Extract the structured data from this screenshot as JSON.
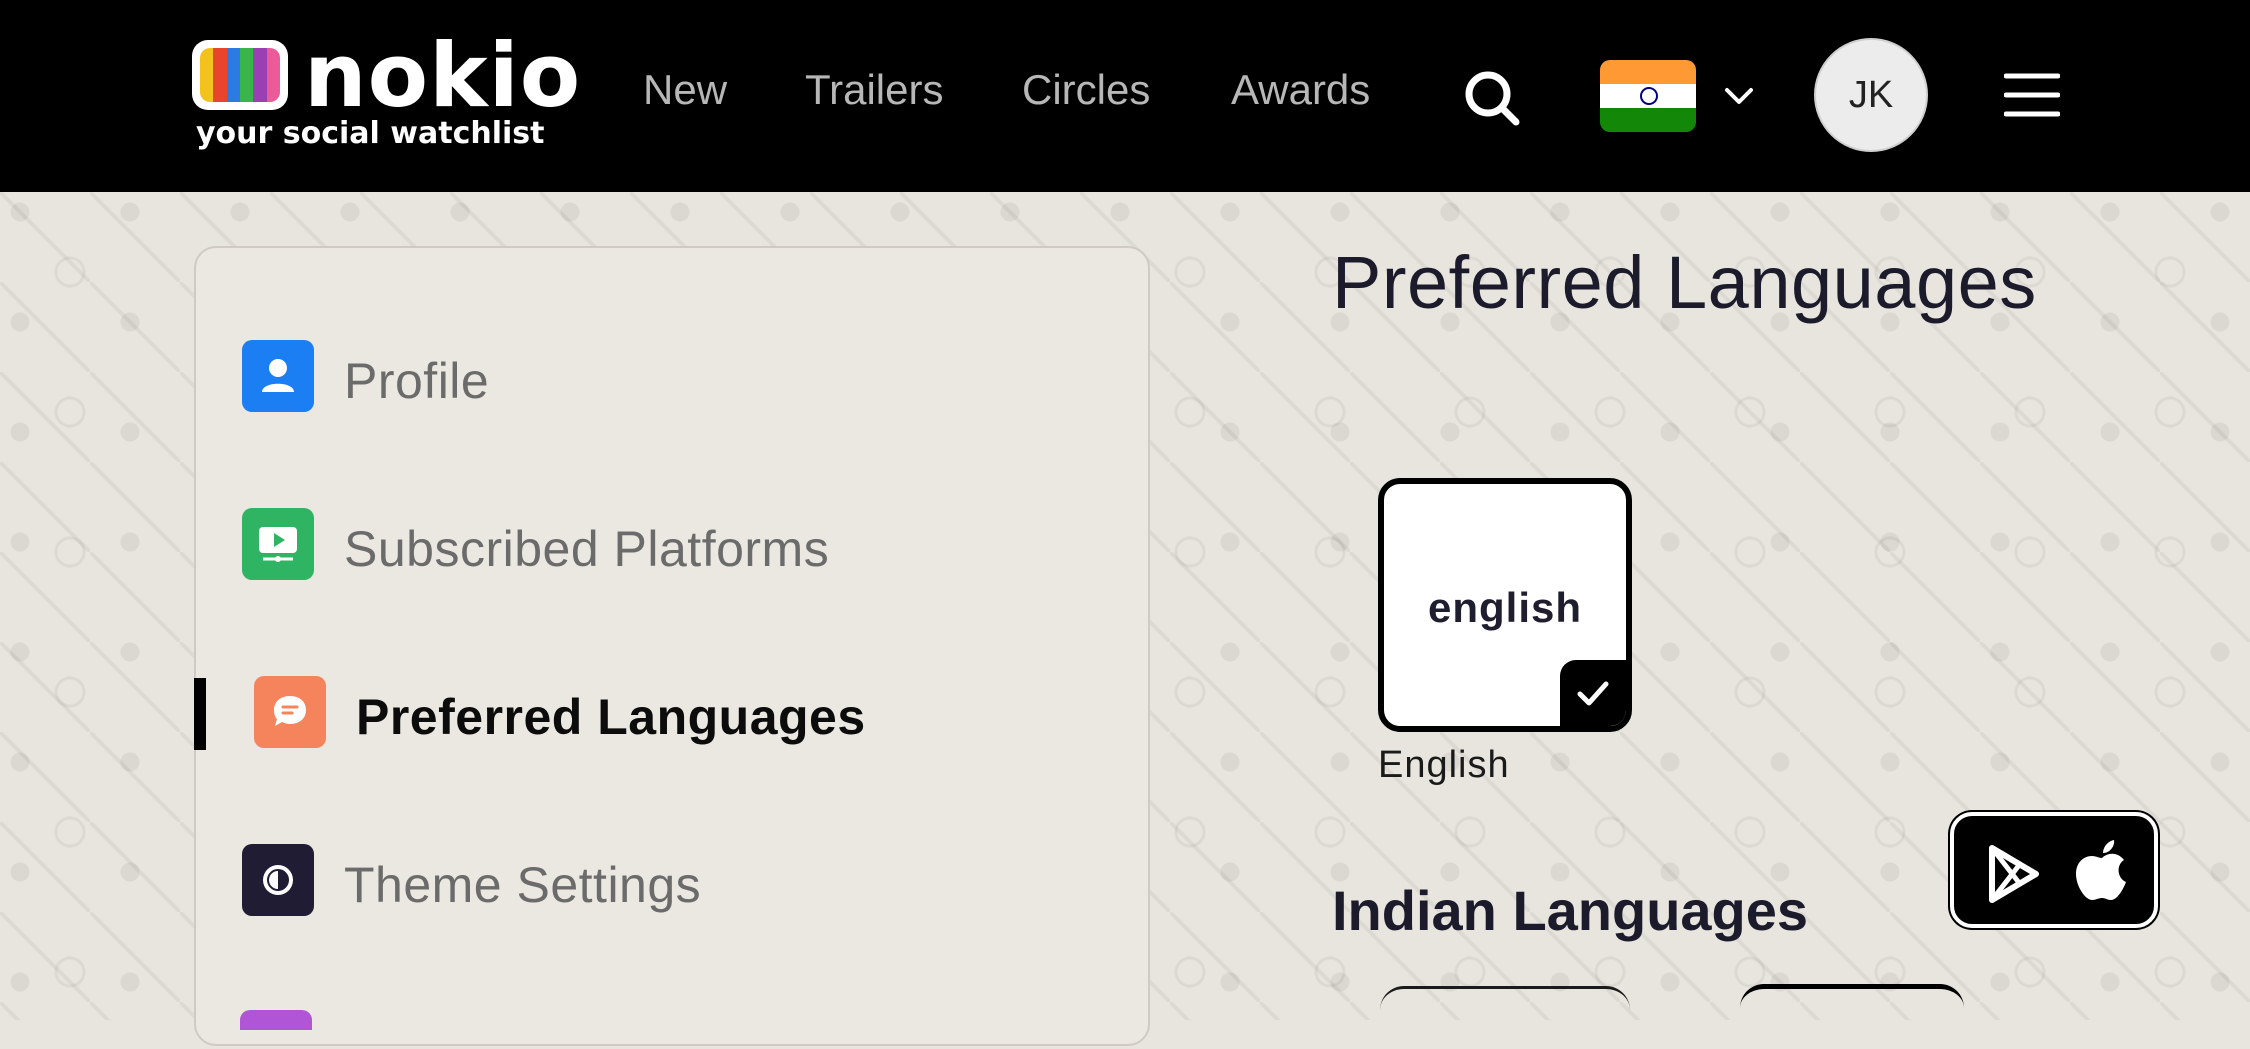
{
  "header": {
    "logo_word": "nokio",
    "logo_tagline": "your social watchlist",
    "nav": [
      {
        "label": "New"
      },
      {
        "label": "Trailers"
      },
      {
        "label": "Circles"
      },
      {
        "label": "Awards"
      }
    ],
    "search_icon": "search-icon",
    "country_flag": "india-flag-icon",
    "avatar_initials": "JK",
    "menu_icon": "hamburger-menu-icon"
  },
  "sidebar": {
    "items": [
      {
        "label": "Profile",
        "icon": "user-icon",
        "color": "#1b7ef2"
      },
      {
        "label": "Subscribed Platforms",
        "icon": "tv-play-icon",
        "color": "#2fb463"
      },
      {
        "label": "Preferred Languages",
        "icon": "chat-bubble-icon",
        "color": "#f5835c",
        "active": true
      },
      {
        "label": "Theme Settings",
        "icon": "theme-contrast-icon",
        "color": "#1f1c33"
      }
    ]
  },
  "main": {
    "title": "Preferred Languages",
    "selected_languages": [
      {
        "card_text": "english",
        "caption": "English",
        "selected": true
      }
    ],
    "indian_section_title": "Indian Languages"
  },
  "app_badge": {
    "play_store_icon": "google-play-icon",
    "app_store_icon": "apple-icon"
  },
  "colors": {
    "header_bg": "#000000",
    "page_bg": "#e8e5de",
    "active_text": "#0c0c0c",
    "inactive_text": "#6b6b6b"
  }
}
